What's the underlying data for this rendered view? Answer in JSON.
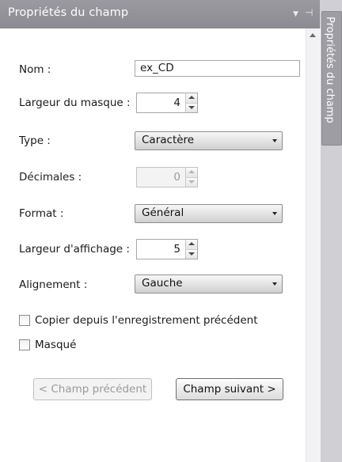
{
  "panel": {
    "title": "Propriétés du champ",
    "side_tab": "Propriétés du champ"
  },
  "form": {
    "name": {
      "label": "Nom :",
      "value": "ex_CD"
    },
    "mask_width": {
      "label": "Largeur du masque :",
      "value": "4"
    },
    "type": {
      "label": "Type :",
      "value": "Caractère"
    },
    "decimals": {
      "label": "Décimales :",
      "value": "0"
    },
    "format": {
      "label": "Format :",
      "value": "Général"
    },
    "display_width": {
      "label": "Largeur d'affichage :",
      "value": "5"
    },
    "alignment": {
      "label": "Alignement :",
      "value": "Gauche"
    },
    "copy_previous": {
      "label": "Copier depuis l'enregistrement précédent",
      "checked": false
    },
    "hidden": {
      "label": "Masqué",
      "checked": false
    }
  },
  "buttons": {
    "previous": "< Champ précédent",
    "next": "Champ suivant >"
  },
  "icons": {
    "menu": "chevron-down-icon",
    "pin": "pin-icon",
    "scroll_up": "arrow-up-icon"
  }
}
